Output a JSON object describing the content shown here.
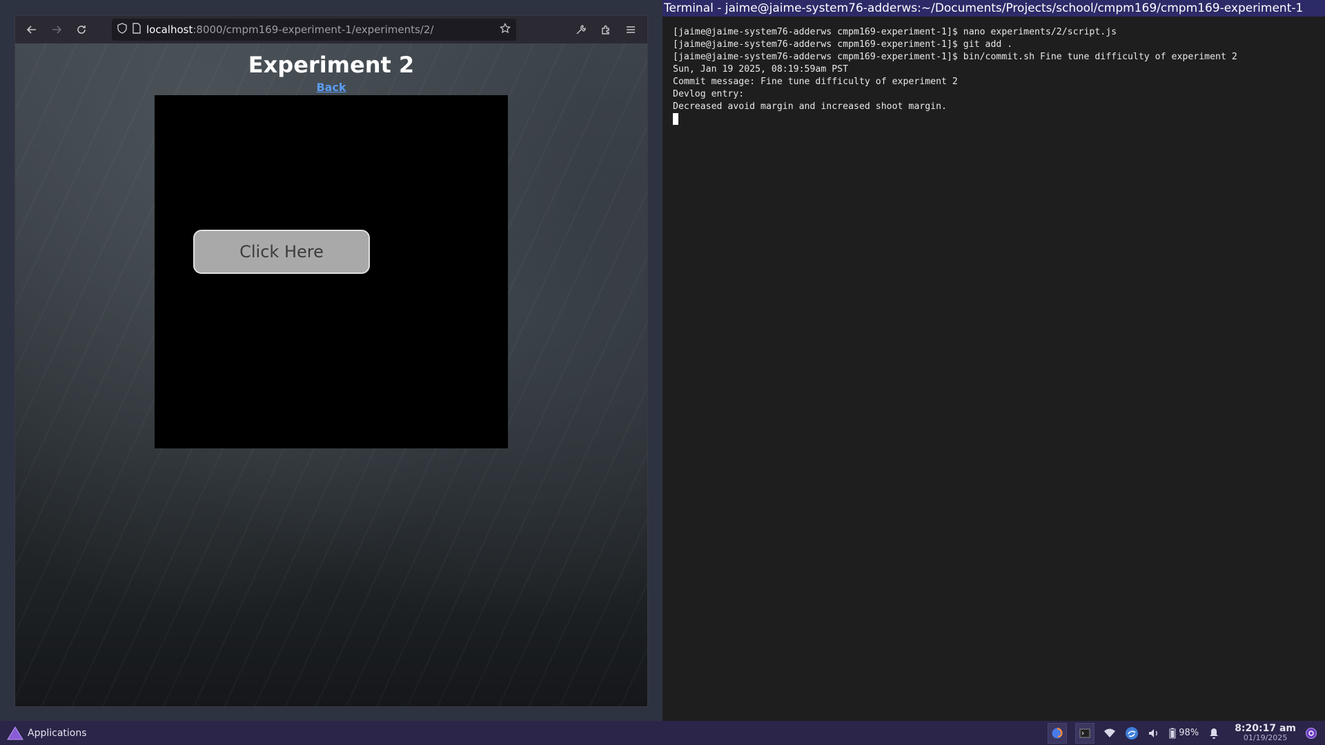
{
  "browser": {
    "url_host": "localhost",
    "url_path": ":8000/cmpm169-experiment-1/experiments/2/",
    "icons": [
      "back-arrow-icon",
      "forward-arrow-icon",
      "reload-icon",
      "shield-icon",
      "page-icon",
      "star-icon",
      "wrench-icon",
      "extensions-icon",
      "menu-icon"
    ]
  },
  "page": {
    "title": "Experiment 2",
    "back_link": "Back",
    "game_button": "Click Here"
  },
  "terminal": {
    "title": "Terminal - jaime@jaime-system76-adderws:~/Documents/Projects/school/cmpm169/cmpm169-experiment-1",
    "lines": [
      "[jaime@jaime-system76-adderws cmpm169-experiment-1]$ nano experiments/2/script.js",
      "[jaime@jaime-system76-adderws cmpm169-experiment-1]$ git add .",
      "[jaime@jaime-system76-adderws cmpm169-experiment-1]$ bin/commit.sh Fine tune difficulty of experiment 2",
      "Sun, Jan 19 2025, 08:19:59am PST",
      "Commit message: Fine tune difficulty of experiment 2",
      "Devlog entry:",
      "Decreased avoid margin and increased shoot margin."
    ]
  },
  "taskbar": {
    "applications_label": "Applications",
    "battery": "98%",
    "time": "8:20:17 am",
    "date": "01/19/2025"
  },
  "colors": {
    "taskbar_bg": "#2a2549",
    "terminal_title_bg": "#2d2a68",
    "link": "#5b9cf0"
  }
}
